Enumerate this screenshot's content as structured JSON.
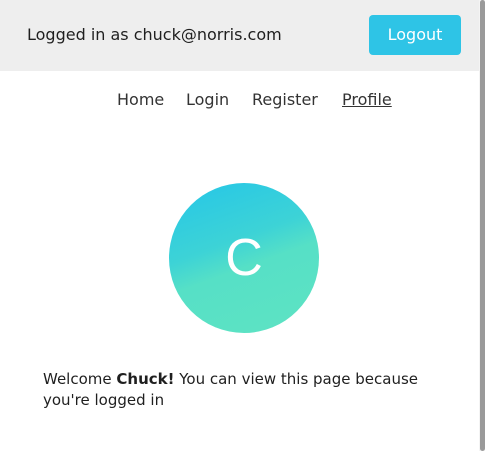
{
  "header": {
    "login_status": "Logged in as chuck@norris.com",
    "logout_label": "Logout"
  },
  "nav": {
    "items": [
      {
        "label": "Home",
        "active": false
      },
      {
        "label": "Login",
        "active": false
      },
      {
        "label": "Register",
        "active": false
      },
      {
        "label": "Profile",
        "active": true
      }
    ]
  },
  "profile": {
    "avatar_letter": "C",
    "welcome_prefix": "Welcome ",
    "user_name": "Chuck!",
    "welcome_suffix": " You can view this page because you're logged in"
  },
  "colors": {
    "header_bg": "#eeeeee",
    "accent": "#2ec4e6",
    "avatar_gradient_start": "#25c6e8",
    "avatar_gradient_end": "#5ee3c3"
  }
}
